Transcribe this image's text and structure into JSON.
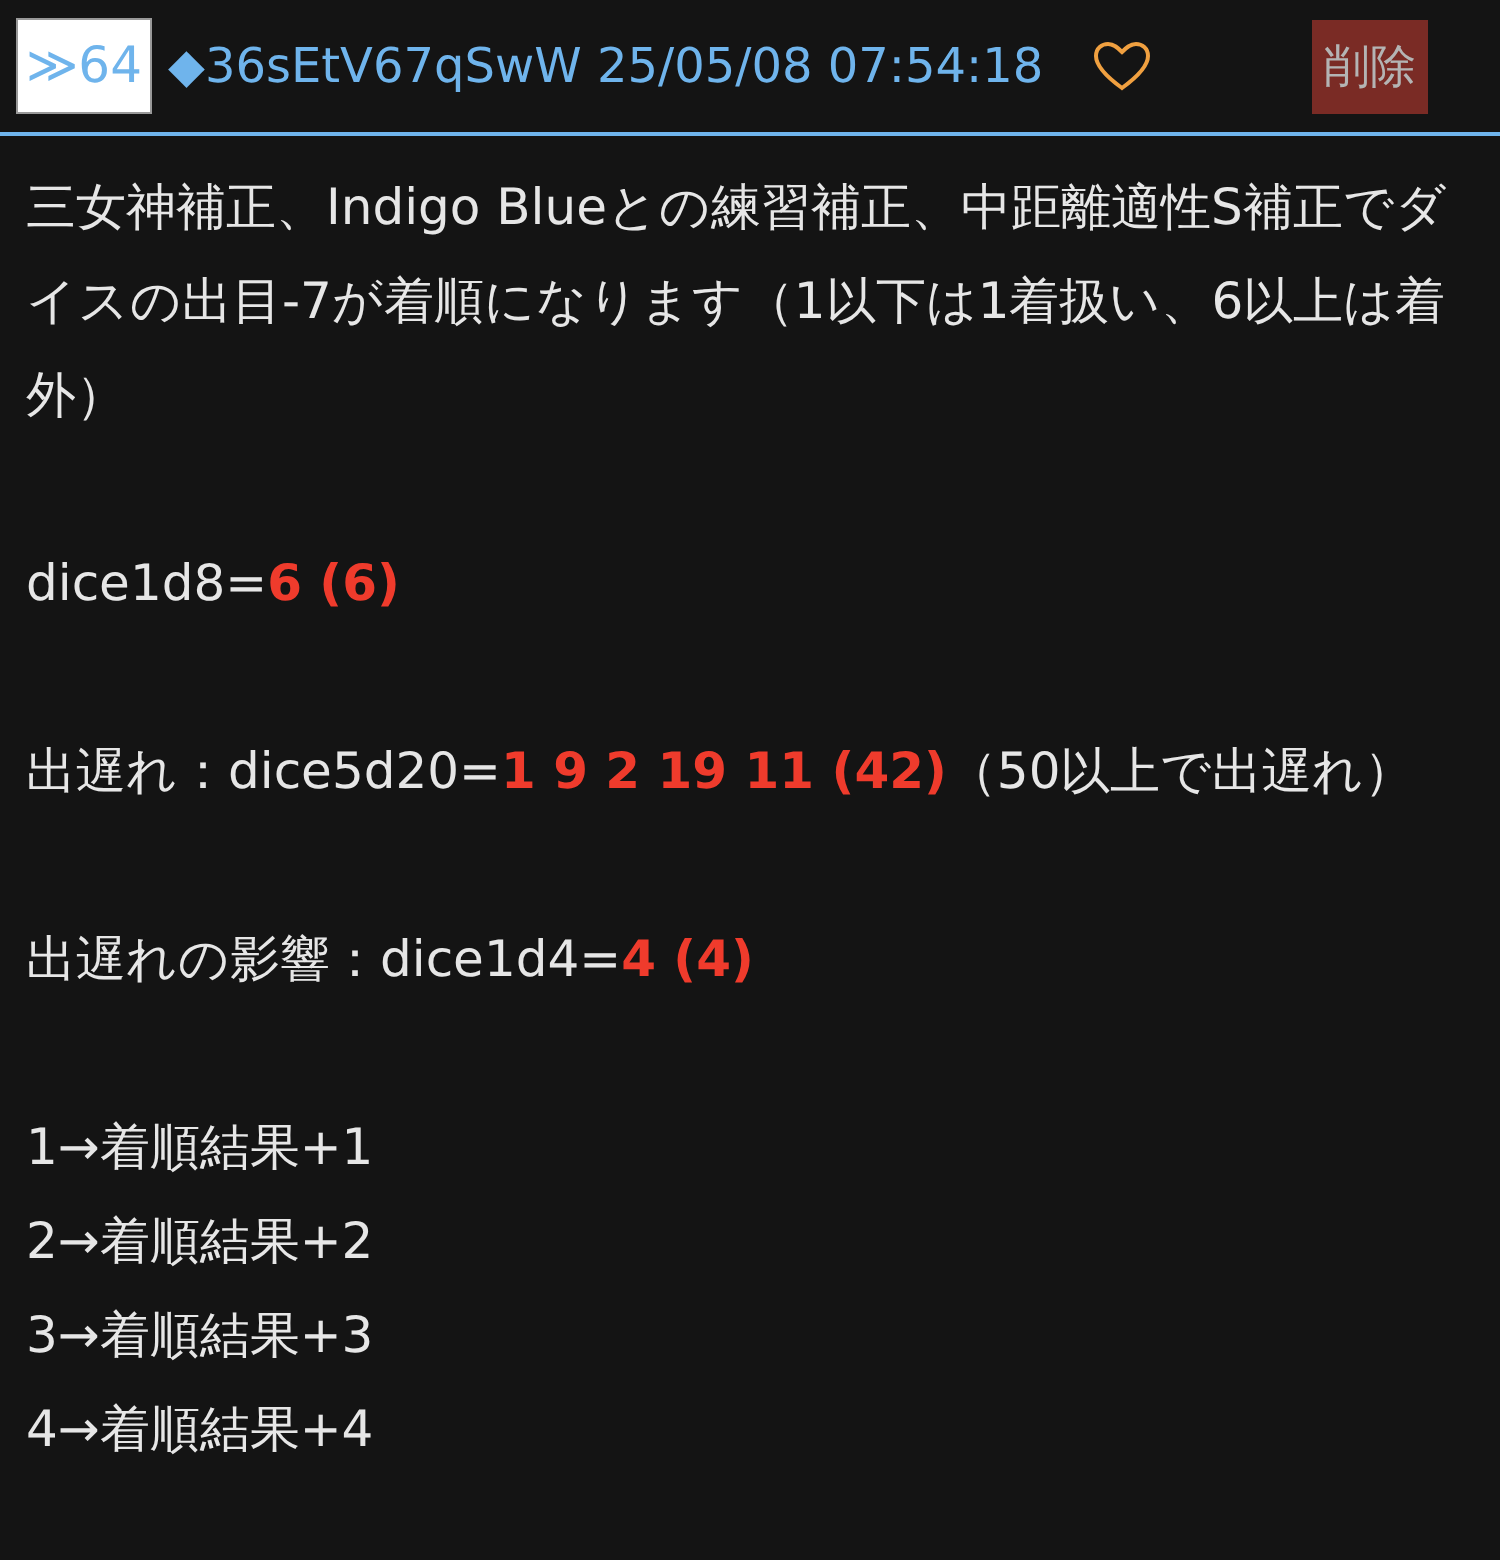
{
  "post": {
    "number": "≫64",
    "author": "◆36sEtV67qSwW 25/05/08 07:54:18",
    "liked": false,
    "delete_label": "削除"
  },
  "blocks": [
    [
      [
        {
          "kind": "plain",
          "text": "三女神補正、Indigo Blueとの練習補正、中距離適性S補正でダイスの出目-7が着順になります（1以下は1着扱い、6以上は着外）"
        }
      ]
    ],
    [
      [
        {
          "kind": "plain",
          "text": "dice1d8="
        },
        {
          "kind": "result",
          "text": "6 (6)"
        }
      ]
    ],
    [
      [
        {
          "kind": "plain",
          "text": "出遅れ：dice5d20="
        },
        {
          "kind": "result",
          "text": "1 9 2 19 11 (42)"
        },
        {
          "kind": "plain",
          "text": "（50以上で出遅れ）"
        }
      ]
    ],
    [
      [
        {
          "kind": "plain",
          "text": "出遅れの影響：dice1d4="
        },
        {
          "kind": "result",
          "text": "4 (4)"
        }
      ]
    ],
    [
      [
        {
          "kind": "plain",
          "text": "1→着順結果+1"
        }
      ],
      [
        {
          "kind": "plain",
          "text": "2→着順結果+2"
        }
      ],
      [
        {
          "kind": "plain",
          "text": "3→着順結果+3"
        }
      ],
      [
        {
          "kind": "plain",
          "text": "4→着順結果+4"
        }
      ]
    ]
  ]
}
